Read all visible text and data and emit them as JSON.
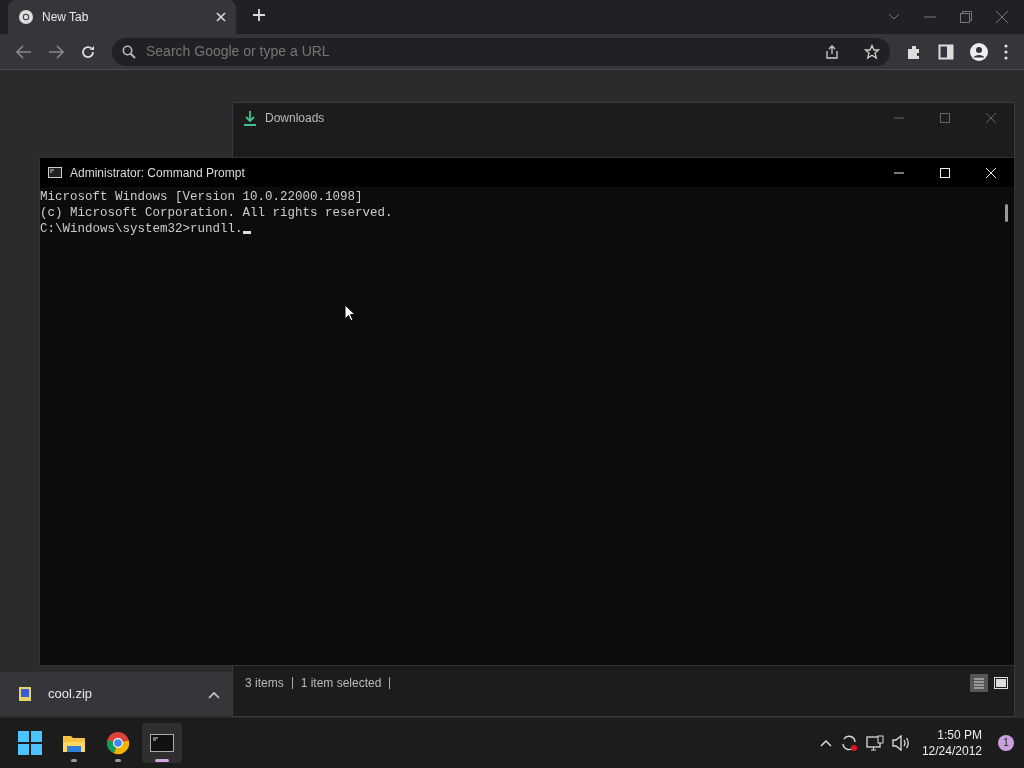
{
  "browser": {
    "tabs": [
      {
        "label": "New Tab",
        "selected": true
      }
    ],
    "omnibox": {
      "placeholder": "Search Google or type a URL"
    }
  },
  "downloads_window": {
    "title": "Downloads",
    "status_bar": [
      "3 items",
      "1 item selected"
    ]
  },
  "cmd_window": {
    "title": "Administrator: Command Prompt",
    "lines": [
      "Microsoft Windows [Version 10.0.22000.1098]",
      "(c) Microsoft Corporation. All rights reserved.",
      "C:\\Windows\\system32>rundll."
    ]
  },
  "download_shelf": {
    "items": [
      {
        "name": "cool.zip"
      }
    ]
  },
  "taskbar": {
    "apps": [
      {
        "kind": "explorer",
        "selected": false
      },
      {
        "kind": "chrome",
        "selected": false
      },
      {
        "kind": "terminal",
        "selected": true
      }
    ],
    "time": "1:50 PM",
    "date": "12/24/2012",
    "notification_count": "1"
  }
}
